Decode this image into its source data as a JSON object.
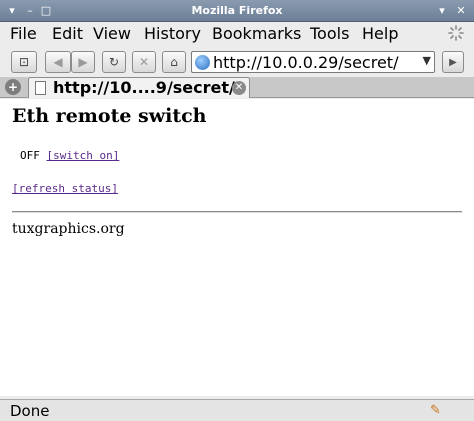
{
  "window": {
    "title": "Mozilla Firefox"
  },
  "menu": {
    "file": "File",
    "edit": "Edit",
    "view": "View",
    "history": "History",
    "bookmarks": "Bookmarks",
    "tools": "Tools",
    "help": "Help"
  },
  "navigation": {
    "url": "http://10.0.0.29/secret/"
  },
  "tab": {
    "label": "http://10....9/secret/"
  },
  "page": {
    "heading": "Eth remote switch",
    "state": "OFF",
    "switch_link": "[switch on]",
    "refresh_link": "[refresh status]",
    "footer": "tuxgraphics.org"
  },
  "statusbar": {
    "text": "Done"
  },
  "colors": {
    "visited_link": "#5a2a8a",
    "titlebar": "#7b8da4"
  }
}
